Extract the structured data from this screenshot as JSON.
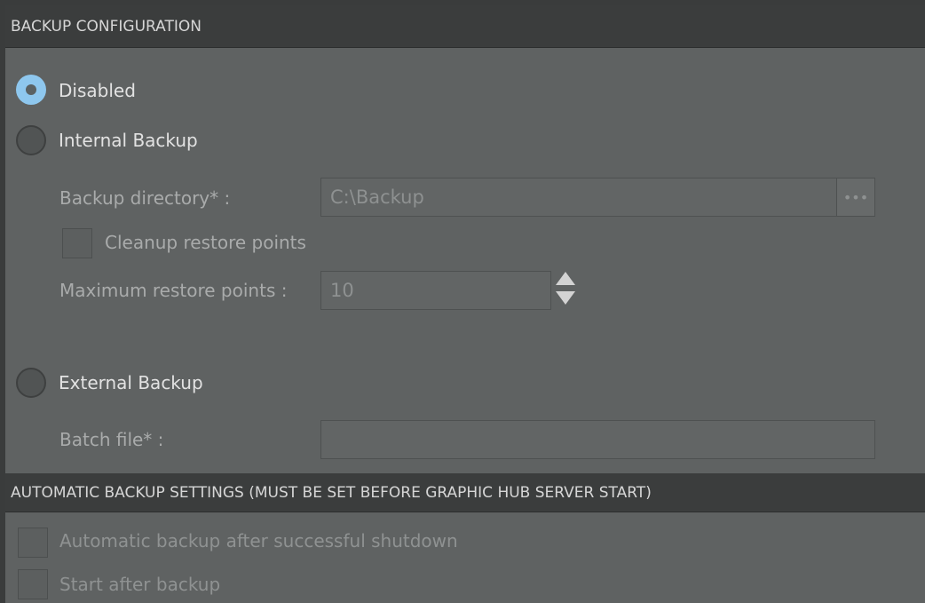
{
  "backup_configuration": {
    "header": "BACKUP CONFIGURATION",
    "options": {
      "disabled": "Disabled",
      "internal": "Internal Backup",
      "external": "External Backup"
    },
    "selected": "Disabled",
    "internal_backup": {
      "directory_label": "Backup directory* :",
      "directory_value": "C:\\Backup",
      "browse_label": "•••",
      "cleanup_label": "Cleanup restore points",
      "cleanup_checked": false,
      "max_restore_label": "Maximum restore points :",
      "max_restore_value": "10"
    },
    "external_backup": {
      "batch_file_label": "Batch file* :",
      "batch_file_value": ""
    }
  },
  "automatic_backup_settings": {
    "header": "AUTOMATIC BACKUP SETTINGS (MUST BE SET BEFORE GRAPHIC HUB SERVER START)",
    "after_shutdown_label": "Automatic backup after successful shutdown",
    "after_shutdown_checked": false,
    "start_after_label": "Start after backup",
    "start_after_checked": false
  },
  "colors": {
    "background": "#5f6262",
    "header_bg": "#3b3d3d",
    "radio_selected": "#8ec7ee",
    "text": "#e2e2e2",
    "disabled_text": "#a9abab"
  }
}
